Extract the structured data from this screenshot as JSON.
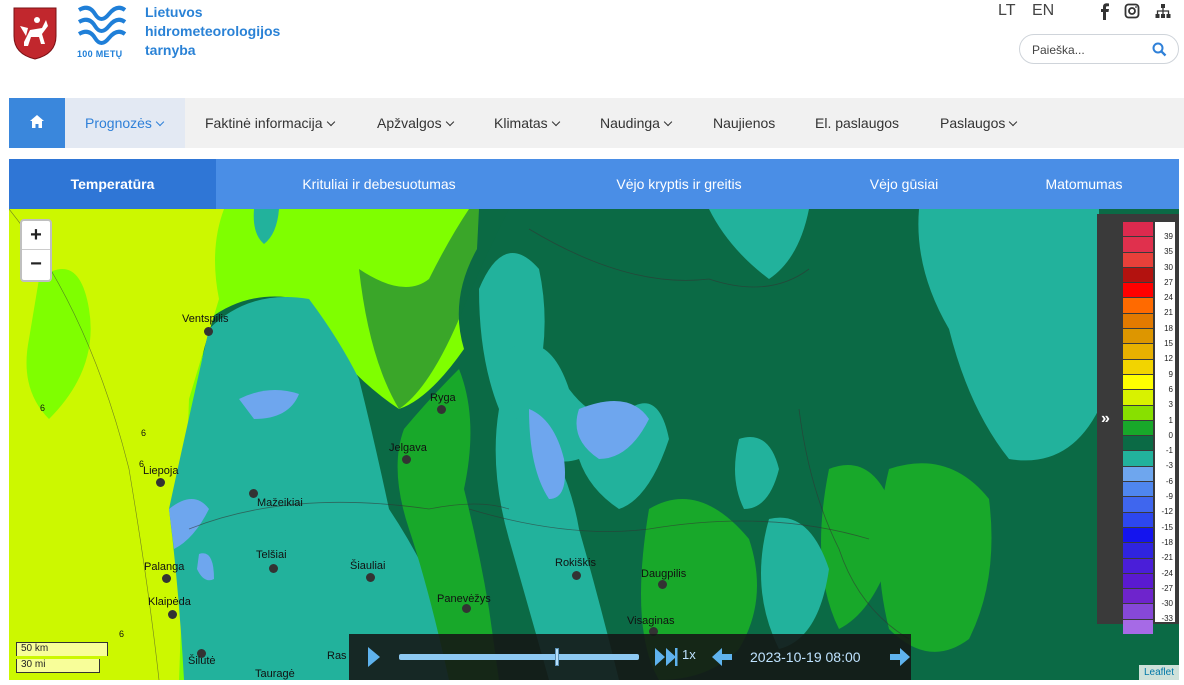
{
  "header": {
    "org_name_line1": "Lietuvos",
    "org_name_line2": "hidrometeorologijos",
    "org_name_line3": "tarnyba",
    "logo_caption": "100 METŲ",
    "lang_lt": "LT",
    "lang_en": "EN",
    "search_placeholder": "Paieška...",
    "social_icons": [
      "facebook-icon",
      "instagram-icon",
      "sitemap-icon"
    ]
  },
  "main_nav": {
    "home_icon": "home-icon",
    "items": [
      {
        "label": "Prognozės",
        "dropdown": true,
        "active": true
      },
      {
        "label": "Faktinė informacija",
        "dropdown": true
      },
      {
        "label": "Apžvalgos",
        "dropdown": true
      },
      {
        "label": "Klimatas",
        "dropdown": true
      },
      {
        "label": "Naudinga",
        "dropdown": true
      },
      {
        "label": "Naujienos",
        "dropdown": false
      },
      {
        "label": "El. paslaugos",
        "dropdown": false
      },
      {
        "label": "Paslaugos",
        "dropdown": true
      }
    ]
  },
  "sub_tabs": [
    {
      "label": "Temperatūra",
      "active": true
    },
    {
      "label": "Krituliai ir debesuotumas"
    },
    {
      "label": "Vėjo kryptis ir greitis"
    },
    {
      "label": "Vėjo gūsiai"
    },
    {
      "label": "Matomumas"
    }
  ],
  "map": {
    "cities": [
      "Ventspilis",
      "Ryga",
      "Jelgava",
      "Liepoja",
      "Mažeikiai",
      "Telšiai",
      "Šiauliai",
      "Palanga",
      "Klaipėda",
      "Panevėžys",
      "Rokiškis",
      "Daugpilis",
      "Visaginas",
      "Šilutė",
      "Tauragė",
      "Ras"
    ],
    "contour_labels": [
      "6",
      "6",
      "6",
      "6"
    ],
    "scale_km": "50 km",
    "scale_mi": "30 mi",
    "attribution": "Leaflet",
    "zoom_in": "+",
    "zoom_out": "−"
  },
  "legend": {
    "toggle": "»",
    "colors": [
      "#dd2a4e",
      "#e0304d",
      "#e8403a",
      "#b3120f",
      "#ff0000",
      "#ff6a00",
      "#e27a00",
      "#dd9600",
      "#e8b100",
      "#f2d400",
      "#ffff00",
      "#d8f200",
      "#88e000",
      "#18a82a",
      "#0b6a45",
      "#22b29c",
      "#6ea6ee",
      "#4f86ee",
      "#3f66ee",
      "#2d47ee",
      "#1414ee",
      "#2f24e0",
      "#4a1ed8",
      "#5a1ad0",
      "#6e24cc",
      "#8648d8",
      "#a66ae6"
    ],
    "labels": [
      "39",
      "35",
      "30",
      "27",
      "24",
      "21",
      "18",
      "15",
      "12",
      "9",
      "6",
      "3",
      "1",
      "0",
      "-1",
      "-3",
      "-6",
      "-9",
      "-12",
      "-15",
      "-18",
      "-21",
      "-24",
      "-27",
      "-30",
      "-33"
    ]
  },
  "player": {
    "speed": "1x",
    "datetime": "2023-10-19 08:00",
    "progress": 0.66
  }
}
